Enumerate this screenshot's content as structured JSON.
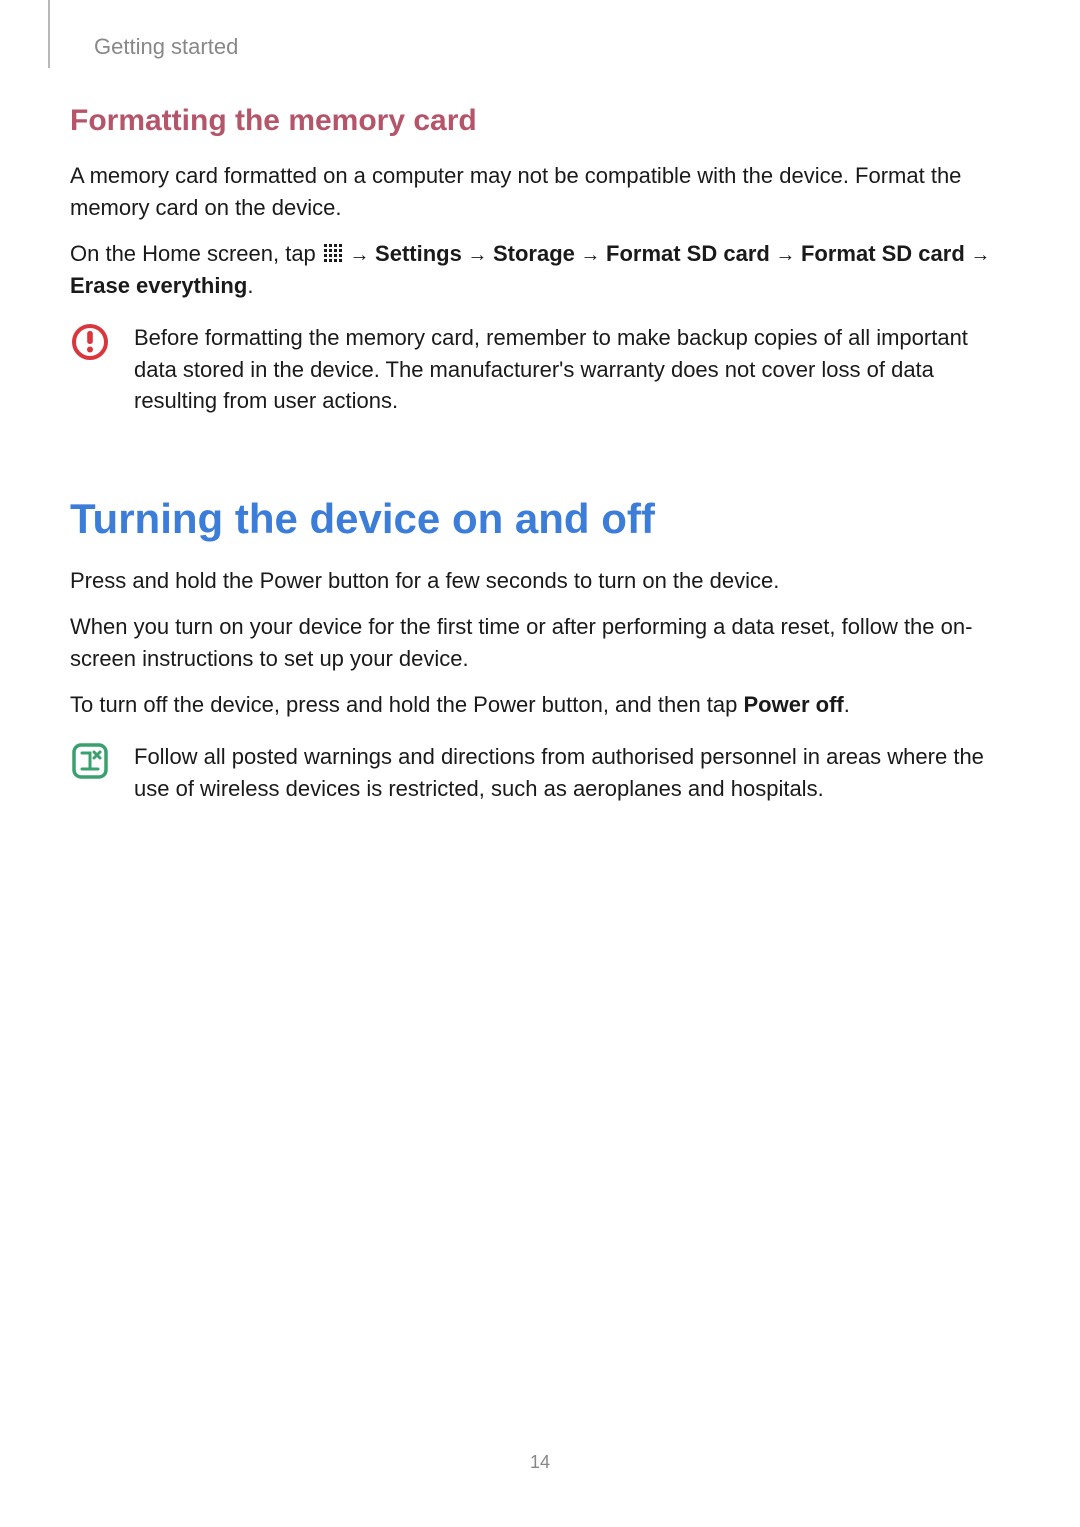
{
  "chapter": "Getting started",
  "section1": {
    "title": "Formatting the memory card",
    "para1": "A memory card formatted on a computer may not be compatible with the device. Format the memory card on the device.",
    "steps": {
      "prefix": "On the Home screen, tap ",
      "sep": " → ",
      "s1": "Settings",
      "s2": "Storage",
      "s3": "Format SD card",
      "s4": "Format SD card",
      "s5": "Erase everything",
      "period": "."
    },
    "warning": "Before formatting the memory card, remember to make backup copies of all important data stored in the device. The manufacturer's warranty does not cover loss of data resulting from user actions."
  },
  "section2": {
    "title": "Turning the device on and off",
    "para1": "Press and hold the Power button for a few seconds to turn on the device.",
    "para2": "When you turn on your device for the first time or after performing a data reset, follow the on-screen instructions to set up your device.",
    "para3_a": "To turn off the device, press and hold the Power button, and then tap ",
    "para3_b": "Power off",
    "para3_c": ".",
    "info": "Follow all posted warnings and directions from authorised personnel in areas where the use of wireless devices is restricted, such as aeroplanes and hospitals."
  },
  "pageNumber": "14"
}
